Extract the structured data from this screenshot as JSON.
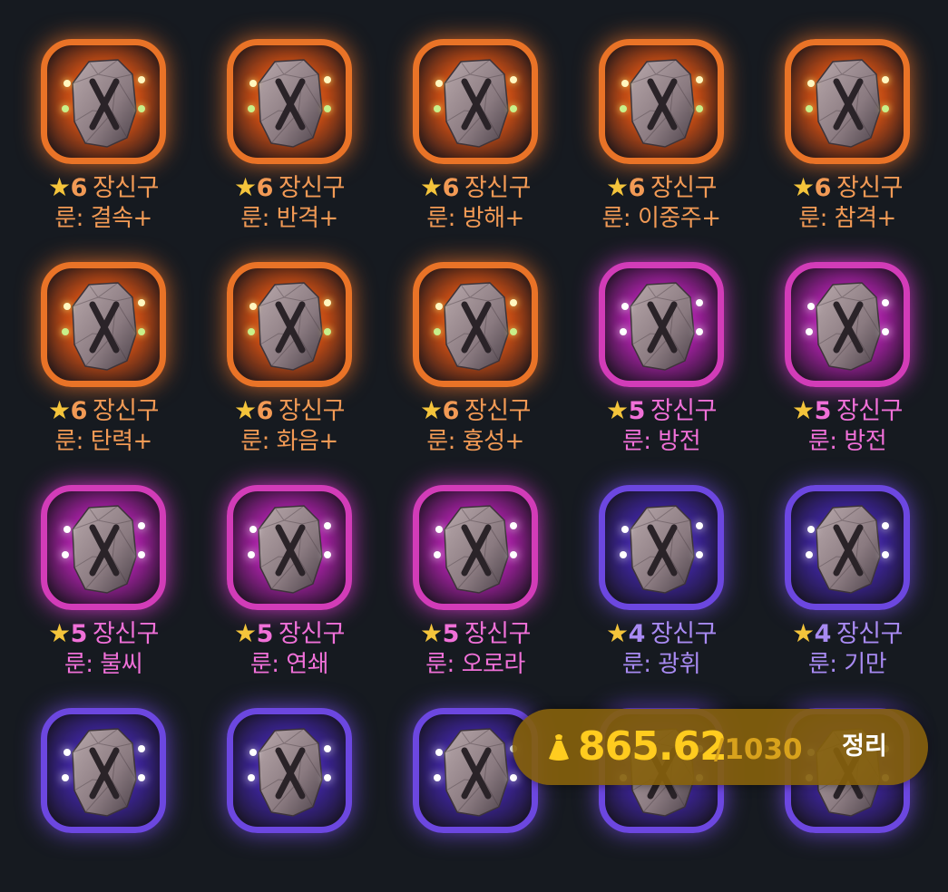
{
  "items": [
    {
      "tier": "orange",
      "stars": "6",
      "name": "장신구",
      "rune": "룬: 결속+"
    },
    {
      "tier": "orange",
      "stars": "6",
      "name": "장신구",
      "rune": "룬: 반격+"
    },
    {
      "tier": "orange",
      "stars": "6",
      "name": "장신구",
      "rune": "룬: 방해+"
    },
    {
      "tier": "orange",
      "stars": "6",
      "name": "장신구",
      "rune": "룬: 이중주+"
    },
    {
      "tier": "orange",
      "stars": "6",
      "name": "장신구",
      "rune": "룬: 참격+"
    },
    {
      "tier": "orange",
      "stars": "6",
      "name": "장신구",
      "rune": "룬: 탄력+"
    },
    {
      "tier": "orange",
      "stars": "6",
      "name": "장신구",
      "rune": "룬: 화음+"
    },
    {
      "tier": "orange",
      "stars": "6",
      "name": "장신구",
      "rune": "룬: 흉성+"
    },
    {
      "tier": "pink",
      "stars": "5",
      "name": "장신구",
      "rune": "룬: 방전"
    },
    {
      "tier": "pink",
      "stars": "5",
      "name": "장신구",
      "rune": "룬: 방전"
    },
    {
      "tier": "pink",
      "stars": "5",
      "name": "장신구",
      "rune": "룬: 불씨"
    },
    {
      "tier": "pink",
      "stars": "5",
      "name": "장신구",
      "rune": "룬: 연쇄"
    },
    {
      "tier": "pink",
      "stars": "5",
      "name": "장신구",
      "rune": "룬: 오로라"
    },
    {
      "tier": "purple",
      "stars": "4",
      "name": "장신구",
      "rune": "룬: 광휘"
    },
    {
      "tier": "purple",
      "stars": "4",
      "name": "장신구",
      "rune": "룬: 기만"
    },
    {
      "tier": "purple",
      "stars": "",
      "name": "",
      "rune": ""
    },
    {
      "tier": "purple",
      "stars": "",
      "name": "",
      "rune": ""
    },
    {
      "tier": "purple",
      "stars": "",
      "name": "",
      "rune": ""
    },
    {
      "tier": "purple",
      "stars": "",
      "name": "",
      "rune": ""
    },
    {
      "tier": "purple",
      "stars": "",
      "name": "",
      "rune": ""
    }
  ],
  "star_glyph": "★",
  "rune_icon": "rune-stone-x-icon",
  "weight": {
    "current": "865.62",
    "max": "/1030",
    "icon": "weight-bag-icon"
  },
  "sort_button": "정리",
  "colors": {
    "background": "#161a20",
    "orange": "#e97327",
    "pink": "#d23cb8",
    "purple": "#6c47e0",
    "star": "#f4c43b",
    "weight_text": "#ffcc1f"
  }
}
